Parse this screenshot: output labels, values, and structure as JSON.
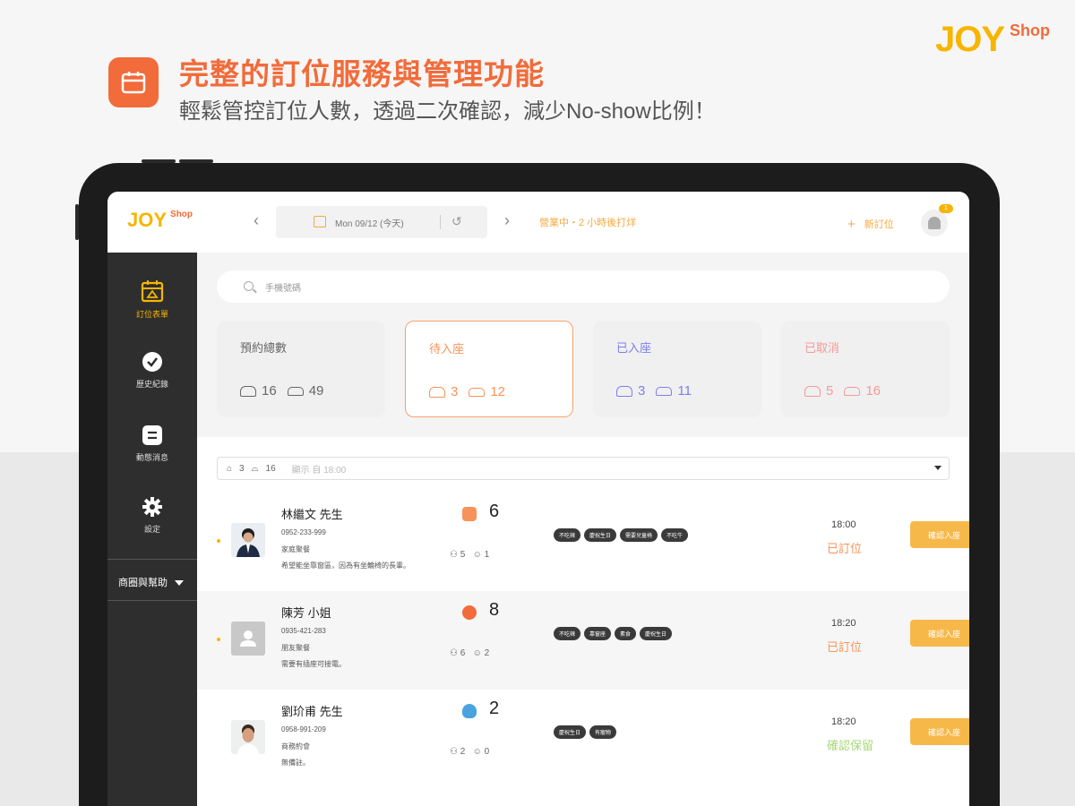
{
  "banner": {
    "title": "完整的訂位服務與管理功能",
    "subtitle": "輕鬆管控訂位人數，透過二次確認，減少No-show比例！",
    "icon": "calendar-icon",
    "accent_color": "#f26b3a"
  },
  "brand": {
    "name": "JOY",
    "suffix": "Shop"
  },
  "app": {
    "header": {
      "logo": "JOY",
      "logo_suffix": "Shop",
      "prev_arrow": "‹",
      "next_arrow": "›",
      "date_label": "Mon 09/12 (今天)",
      "status": "營業中・2 小時後打烊",
      "new_booking": "新訂位",
      "new_booking_plus": "+",
      "notification_count": "1"
    },
    "sidebar": {
      "items": [
        {
          "label": "訂位表單",
          "icon": "calendar-icon"
        },
        {
          "label": "歷史紀錄",
          "icon": "check-circle-icon"
        },
        {
          "label": "動態消息",
          "icon": "list-icon"
        },
        {
          "label": "設定",
          "icon": "gear-icon"
        }
      ],
      "store_selector": "商圈與幫助"
    },
    "search": {
      "placeholder": "手機號碼"
    },
    "stats": [
      {
        "title": "預約總數",
        "groups": "16",
        "people": "49",
        "color": "#666666"
      },
      {
        "title": "待入座",
        "groups": "3",
        "people": "12",
        "color": "#f7935a"
      },
      {
        "title": "已入座",
        "groups": "3",
        "people": "11",
        "color": "#7b7ff0"
      },
      {
        "title": "已取消",
        "groups": "5",
        "people": "16",
        "color": "#f39a9a"
      }
    ],
    "filter": {
      "groups": "3",
      "people": "16",
      "hint": "顯示 自 18:00"
    },
    "reservations": [
      {
        "name": "林繼文 先生",
        "phone": "0952-233-999",
        "source": "家庭聚餐",
        "note": "希望能坐靠窗區，因為有坐輪椅的長輩。",
        "party": "6",
        "adults": "5",
        "children": "1",
        "tags": [
          "不吃辣",
          "慶祝生日",
          "需要兒童椅",
          "不吃牛"
        ],
        "time": "18:00",
        "status": "已訂位",
        "status_color": "#f7935a",
        "action": "確認入座",
        "src_color": "#f7935a"
      },
      {
        "name": "陳芳 小姐",
        "phone": "0935-421-283",
        "source": "朋友聚餐",
        "note": "需要有插座可接電。",
        "party": "8",
        "adults": "6",
        "children": "2",
        "tags": [
          "不吃辣",
          "靠窗座",
          "素食",
          "慶祝生日"
        ],
        "time": "18:20",
        "status": "已訂位",
        "status_color": "#f7935a",
        "action": "確認入座",
        "src_color": "#f26b3a"
      },
      {
        "name": "劉玠甫 先生",
        "phone": "0958-991-209",
        "source": "商務約會",
        "note": "無備註。",
        "party": "2",
        "adults": "2",
        "children": "0",
        "tags": [
          "慶祝生日",
          "有寵物"
        ],
        "time": "18:20",
        "status": "確認保留",
        "status_color": "#a8d87a",
        "action": "確認入座",
        "src_color": "#4aa3df"
      }
    ]
  }
}
